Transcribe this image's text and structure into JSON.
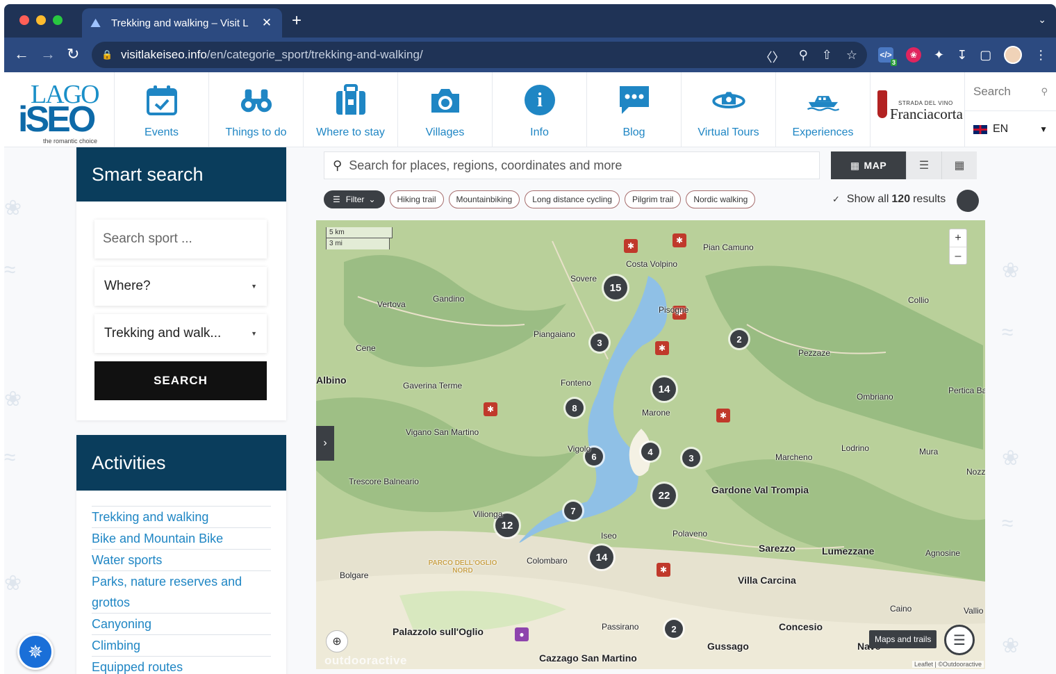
{
  "browser": {
    "tab_title": "Trekking and walking – Visit L",
    "url_host": "visitlakeiseo.info",
    "url_path": "/en/categorie_sport/trekking-and-walking/",
    "ext_badge": "3"
  },
  "site": {
    "logo": {
      "top": "LAGO",
      "main": "iSEO",
      "tagline": "the romantic choice"
    },
    "nav": [
      {
        "label": "Events",
        "icon": "calendar-icon"
      },
      {
        "label": "Things to do",
        "icon": "binoculars-icon"
      },
      {
        "label": "Where to stay",
        "icon": "suitcase-icon"
      },
      {
        "label": "Villages",
        "icon": "camera-icon"
      },
      {
        "label": "Info",
        "icon": "info-icon"
      },
      {
        "label": "Blog",
        "icon": "chat-bubble-icon"
      },
      {
        "label": "Virtual Tours",
        "icon": "360-view-icon"
      },
      {
        "label": "Experiences",
        "icon": "boat-icon"
      }
    ],
    "partner": {
      "small": "STRADA DEL VINO",
      "big": "Franciacorta"
    },
    "search_label": "Search",
    "language": "EN"
  },
  "smart_search": {
    "title": "Smart search",
    "sport_placeholder": "Search sport ...",
    "where": "Where?",
    "category": "Trekking and walk...",
    "button": "SEARCH"
  },
  "activities": {
    "title": "Activities",
    "items": [
      "Trekking and walking",
      "Bike and Mountain Bike",
      "Water sports",
      "Parks, nature reserves and grottos",
      "Canyoning",
      "Climbing",
      "Equipped routes"
    ]
  },
  "map_panel": {
    "search_placeholder": "Search for places, regions, coordinates and more",
    "view_map": "MAP",
    "filter": "Filter",
    "chips": [
      "Hiking trail",
      "Mountainbiking",
      "Long distance cycling",
      "Pilgrim trail",
      "Nordic walking"
    ],
    "show_all_prefix": "Show all",
    "show_all_count": "120",
    "show_all_suffix": "results",
    "scale_km": "5 km",
    "scale_mi": "3 mi",
    "maps_and_trails": "Maps and trails",
    "watermark": "outdooractive",
    "attribution": "Leaflet | ©Outdooractive",
    "clusters": [
      "15",
      "3",
      "2",
      "14",
      "8",
      "4",
      "6",
      "3",
      "22",
      "7",
      "12",
      "14",
      "2"
    ],
    "places": [
      "Pian Camuno",
      "Costa Volpino",
      "Sovere",
      "Pisogne",
      "Vertova",
      "Gandino",
      "Collio",
      "Piangaiano",
      "Cene",
      "Pezzaze",
      "Albino",
      "Gaverina Terme",
      "Fonteno",
      "Ombriano",
      "Pertica Bas",
      "Marone",
      "Vigano San Martino",
      "Lodrino",
      "Marcheno",
      "Mura",
      "Vigolo",
      "Nozza",
      "Trescore Balneario",
      "Gardone Val Trompia",
      "Vilionga",
      "Polaveno",
      "Iseo",
      "Sarezzo",
      "Lumezzane",
      "Agnosine",
      "Colombaro",
      "PARCO DELL'OGLIO NORD",
      "Bolgare",
      "Villa Carcina",
      "Caino",
      "Vallio",
      "Passirano",
      "Palazzolo sull'Oglio",
      "Concesio",
      "Gussago",
      "Cazzago San Martino",
      "Nave"
    ]
  }
}
